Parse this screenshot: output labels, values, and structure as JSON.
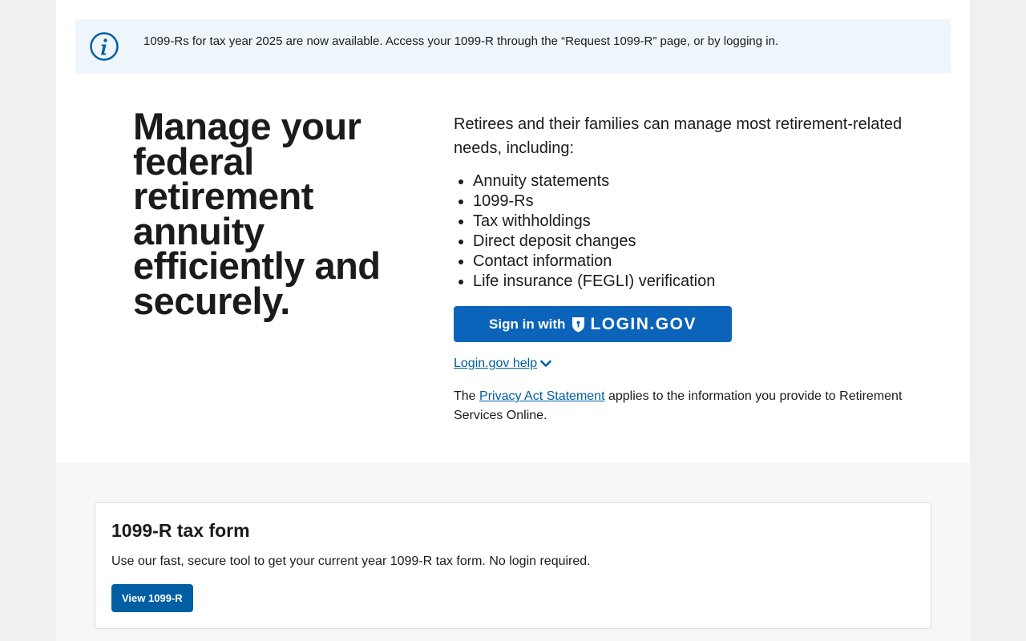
{
  "alert": {
    "icon": "info-icon",
    "text": "1099-Rs for tax year 2025 are now available. Access your 1099-R through the “Request 1099-R” page, or by logging in."
  },
  "hero": {
    "headline": "Manage your federal retirement annuity efficiently and securely.",
    "intro": "Retirees and their families can manage most retirement-related needs, including:",
    "features": [
      "Annuity statements",
      "1099-Rs",
      "Tax withholdings",
      "Direct deposit changes",
      "Contact information",
      "Life insurance (FEGLI) verification"
    ],
    "login_button": {
      "prefix": "Sign in with",
      "brand": "LOGIN.GOV",
      "icon": "shield-icon"
    },
    "help_link": "Login.gov help",
    "privacy": {
      "before": "The ",
      "link": "Privacy Act Statement",
      "after": " applies to the information you provide to Retirement Services Online."
    }
  },
  "card": {
    "title": "1099-R tax form",
    "description": "Use our fast, secure tool to get your current year 1099-R tax form. No login required.",
    "button_label": "View 1099-R"
  },
  "colors": {
    "primary": "#005ea2",
    "login_button": "#0b64ba",
    "alert_background": "#eff6fb",
    "page_background": "#f0f0f0",
    "text": "#1b1b1b"
  }
}
